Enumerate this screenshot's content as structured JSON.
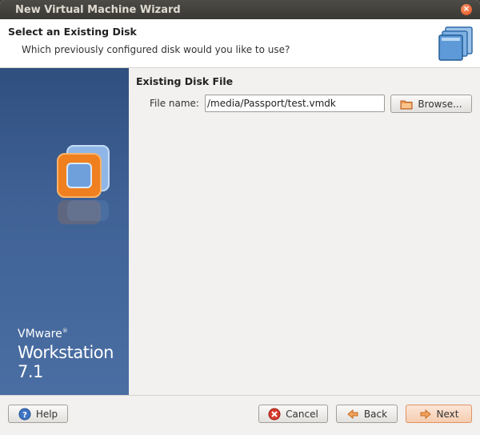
{
  "window": {
    "title": "New Virtual Machine Wizard"
  },
  "header": {
    "title": "Select an Existing Disk",
    "subtitle": "Which previously configured disk would you like to use?"
  },
  "sidebar": {
    "brand_line1": "VMware",
    "brand_mark": "®",
    "brand_line2": "Workstation 7.1"
  },
  "content": {
    "section_title": "Existing Disk File",
    "file_name_label": "File name:",
    "file_name_value": "/media/Passport/test.vmdk",
    "browse_label": "Browse..."
  },
  "footer": {
    "help_label": "Help",
    "cancel_label": "Cancel",
    "back_label": "Back",
    "next_label": "Next"
  },
  "colors": {
    "sidebar": "#3f6194",
    "accent": "#df4a16",
    "next_button": "#f5cdb0"
  },
  "icons": [
    "close-icon",
    "disk-stack-icon",
    "vmware-logo-icon",
    "folder-icon",
    "help-icon",
    "cancel-icon",
    "back-arrow-icon",
    "next-arrow-icon"
  ]
}
